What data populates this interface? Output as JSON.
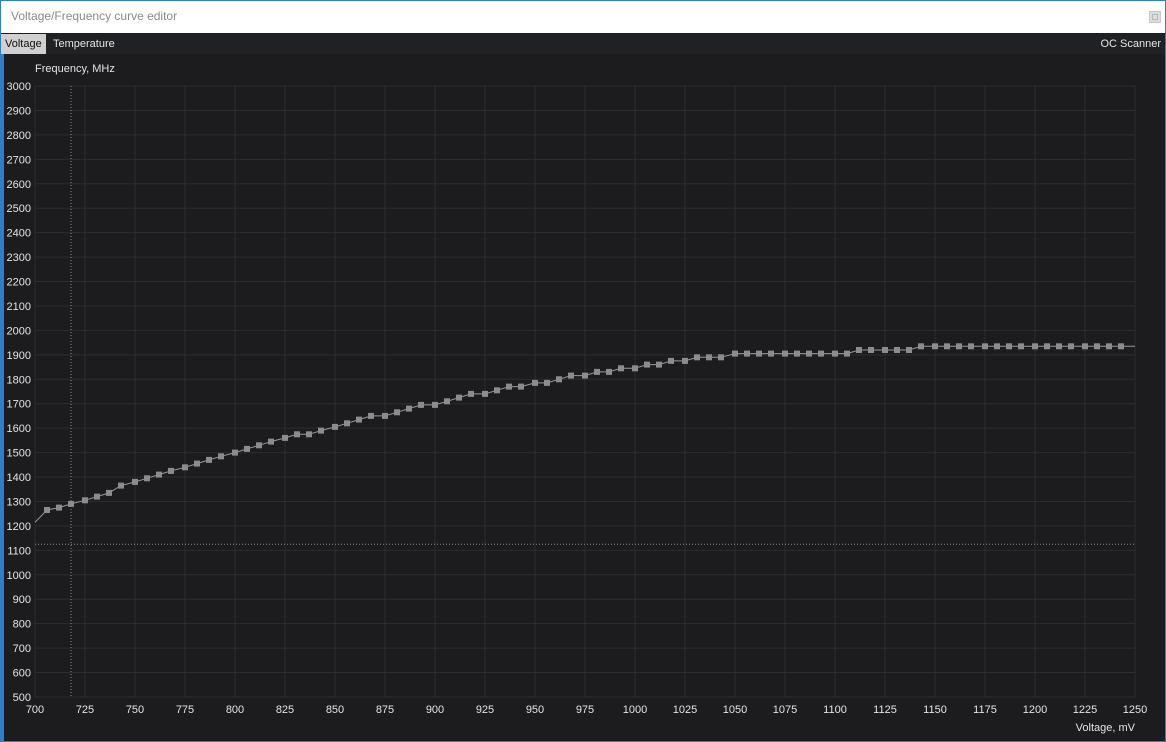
{
  "window": {
    "title": "Voltage/Frequency curve editor"
  },
  "tabs": [
    {
      "label": "Voltage",
      "active": true
    },
    {
      "label": "Temperature",
      "active": false
    }
  ],
  "right_tab": {
    "label": "OC Scanner"
  },
  "colors": {
    "background": "#1c1c1f",
    "grid": "#2c2d31",
    "curve": "#9a9a9a",
    "point": "#8c8c8c",
    "frame_accent": "#2f7fc7"
  },
  "chart_data": {
    "type": "line",
    "ylabel": "Frequency, MHz",
    "xlabel": "Voltage, mV",
    "xlim": [
      700,
      1250
    ],
    "ylim": [
      500,
      3000
    ],
    "x_ticks": [
      700,
      725,
      750,
      775,
      800,
      825,
      850,
      875,
      900,
      925,
      950,
      975,
      1000,
      1025,
      1050,
      1075,
      1100,
      1125,
      1150,
      1175,
      1200,
      1225,
      1250
    ],
    "y_ticks": [
      500,
      600,
      700,
      800,
      900,
      1000,
      1100,
      1200,
      1300,
      1400,
      1500,
      1600,
      1700,
      1800,
      1900,
      2000,
      2100,
      2200,
      2300,
      2400,
      2500,
      2600,
      2700,
      2800,
      2900,
      3000
    ],
    "grid": true,
    "crosshair": {
      "voltage": 718,
      "frequency": 1125
    },
    "series": [
      {
        "x": [
          700,
          706,
          712,
          718,
          725,
          731,
          737,
          743,
          750,
          756,
          762,
          768,
          775,
          781,
          787,
          793,
          800,
          806,
          812,
          818,
          825,
          831,
          837,
          843,
          850,
          856,
          862,
          868,
          875,
          881,
          887,
          893,
          900,
          906,
          912,
          918,
          925,
          931,
          937,
          943,
          950,
          956,
          962,
          968,
          975,
          981,
          987,
          993,
          1000,
          1006,
          1012,
          1018,
          1025,
          1031,
          1037,
          1043,
          1050,
          1056,
          1062,
          1068,
          1075,
          1081,
          1087,
          1093,
          1100,
          1106,
          1112,
          1118,
          1125,
          1131,
          1137,
          1143,
          1150,
          1156,
          1162,
          1168,
          1175,
          1181,
          1187,
          1193,
          1200,
          1206,
          1212,
          1218,
          1225,
          1231,
          1237,
          1243,
          1250
        ],
        "y": [
          1215,
          1265,
          1275,
          1290,
          1305,
          1320,
          1335,
          1365,
          1380,
          1395,
          1410,
          1425,
          1440,
          1455,
          1470,
          1485,
          1500,
          1515,
          1530,
          1545,
          1560,
          1575,
          1575,
          1590,
          1605,
          1620,
          1635,
          1650,
          1650,
          1665,
          1680,
          1695,
          1695,
          1710,
          1725,
          1740,
          1740,
          1755,
          1770,
          1770,
          1785,
          1785,
          1800,
          1815,
          1815,
          1830,
          1830,
          1845,
          1845,
          1860,
          1860,
          1875,
          1875,
          1890,
          1890,
          1890,
          1905,
          1905,
          1905,
          1905,
          1905,
          1905,
          1905,
          1905,
          1905,
          1905,
          1920,
          1920,
          1920,
          1920,
          1920,
          1935,
          1935,
          1935,
          1935,
          1935,
          1935,
          1935,
          1935,
          1935,
          1935,
          1935,
          1935,
          1935,
          1935,
          1935,
          1935,
          1935,
          1935
        ]
      }
    ]
  }
}
